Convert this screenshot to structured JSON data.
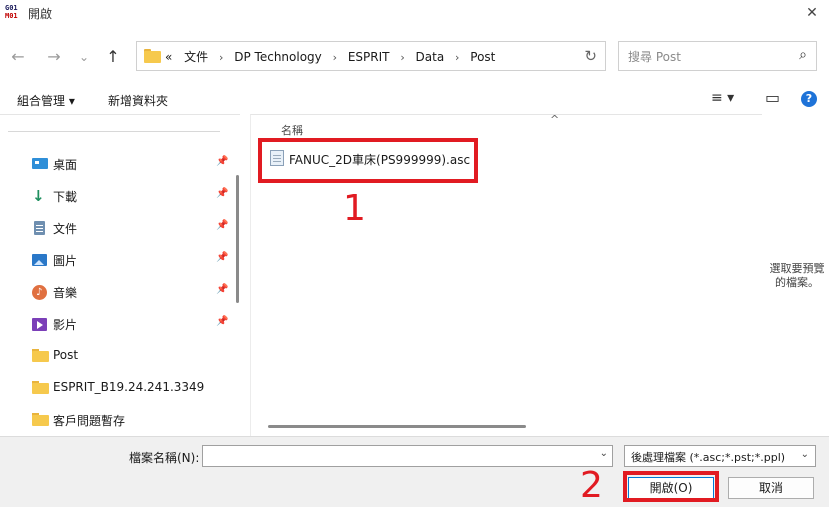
{
  "window": {
    "title": "開啟",
    "app_icon_line1": "G01",
    "app_icon_line2": "M01"
  },
  "nav": {
    "back": "←",
    "forward": "→",
    "recent": "⌄",
    "up": "↑",
    "breadcrumb_prefix": "«",
    "breadcrumbs": [
      "文件",
      "DP Technology",
      "ESPRIT",
      "Data",
      "Post"
    ],
    "refresh": "↻",
    "search_placeholder": "搜尋 Post"
  },
  "toolbar": {
    "organize": "組合管理 ▾",
    "new_folder": "新增資料夾",
    "view_icon": "≡ ▾",
    "pane_icon": "▭",
    "help": "?"
  },
  "sidebar": {
    "items": [
      {
        "label": "桌面",
        "icon": "desktop-icon",
        "pinned": true
      },
      {
        "label": "下載",
        "icon": "download-icon",
        "pinned": true
      },
      {
        "label": "文件",
        "icon": "documents-icon",
        "pinned": true
      },
      {
        "label": "圖片",
        "icon": "pictures-icon",
        "pinned": true
      },
      {
        "label": "音樂",
        "icon": "music-icon",
        "pinned": true
      },
      {
        "label": "影片",
        "icon": "videos-icon",
        "pinned": true
      },
      {
        "label": "Post",
        "icon": "folder-icon",
        "pinned": false
      },
      {
        "label": "ESPRIT_B19.24.241.3349",
        "icon": "folder-icon",
        "pinned": false
      },
      {
        "label": "客戶問題暫存",
        "icon": "folder-icon",
        "pinned": false
      }
    ],
    "pin_glyph": "📌"
  },
  "content": {
    "column_name": "名稱",
    "sort_glyph": "^",
    "files": [
      {
        "name": "FANUC_2D車床(PS999999).asc"
      }
    ],
    "annotation_1": "1"
  },
  "preview": {
    "text": "選取要預覽的檔案。"
  },
  "bottom": {
    "filename_label": "檔案名稱(N):",
    "filename_value": "",
    "filetype": "後處理檔案 (*.asc;*.pst;*.ppl)",
    "open": "開啟(O)",
    "cancel": "取消",
    "annotation_2": "2"
  },
  "colors": {
    "annotation": "#e11b22",
    "folder": "#f6c94d",
    "accent": "#0078d4"
  }
}
